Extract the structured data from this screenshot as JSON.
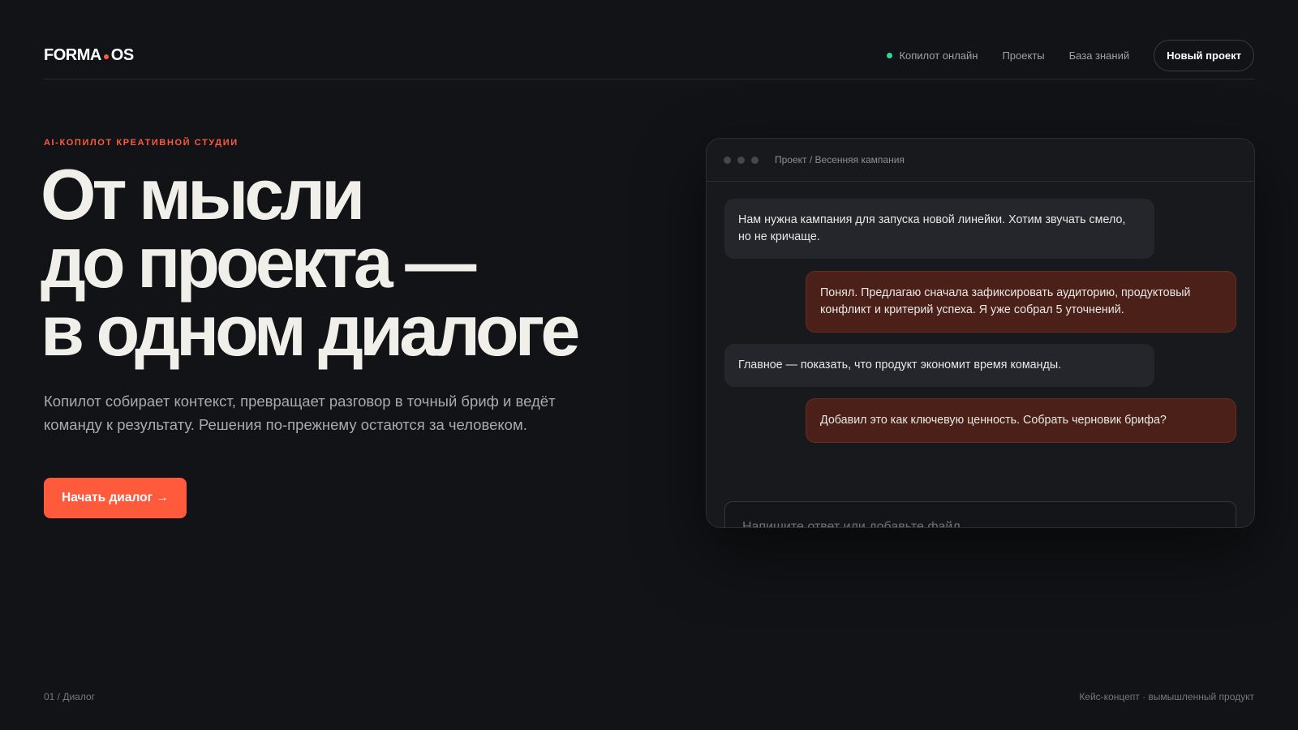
{
  "header": {
    "logo": {
      "left": "FORMA",
      "dot": "●",
      "right": "OS"
    },
    "status": "Копилот онлайн",
    "nav": [
      "Проекты",
      "База знаний"
    ],
    "new_project": "Новый проект"
  },
  "hero": {
    "eyebrow": "AI-КОПИЛОТ КРЕАТИВНОЙ СТУДИИ",
    "headline": [
      "От мысли",
      "до проекта —",
      "в одном диалоге"
    ],
    "lead": "Копилот собирает контекст, превращает разговор в точный бриф и ведёт команду к результату. Решения по-прежнему остаются за человеком.",
    "cta": "Начать диалог →"
  },
  "chat": {
    "title": "Проект / Весенняя кампания",
    "messages": [
      {
        "role": "user",
        "text": "Нам нужна кампания для запуска новой линейки. Хотим звучать смело, но не кричаще."
      },
      {
        "role": "assistant",
        "text": "Понял. Предлагаю сначала зафиксировать аудиторию, продуктовый конфликт и критерий успеха. Я уже собрал 5 уточнений."
      },
      {
        "role": "user",
        "text": "Главное — показать, что продукт экономит время команды."
      },
      {
        "role": "assistant",
        "text": "Добавил это как ключевую ценность. Собрать черновик брифа?"
      }
    ],
    "input_placeholder": "Напишите ответ или добавьте файл…",
    "input_value": ""
  },
  "footer": {
    "left": "01 / Диалог",
    "right": "Кейс-концепт · вымышленный продукт"
  },
  "colors": {
    "background": "#121316",
    "accent": "#ff5a3c",
    "status_online": "#34d399",
    "assistant_bubble": "#4a2018",
    "user_bubble": "#24262c"
  }
}
